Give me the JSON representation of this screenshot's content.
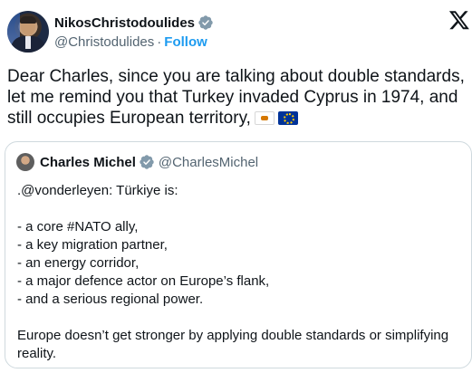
{
  "author": {
    "display_name": "NikosChristodoulides",
    "handle": "@Christodulides",
    "separator": "·",
    "follow_label": "Follow"
  },
  "tweet": {
    "text": "Dear Charles, since you are talking about double standards, let me remind you that Turkey invaded Cyprus in 1974, and still occupies European territory,",
    "emojis": [
      "cyprus-flag",
      "eu-flag"
    ]
  },
  "quoted": {
    "display_name": "Charles Michel",
    "handle": "@CharlesMichel",
    "lines": [
      ".@vonderleyen: Türkiye is:",
      "",
      "- a core #NATO ally,",
      "- a key migration partner,",
      "- an energy corridor,",
      "- a major defence actor on Europe’s flank,",
      "- and a serious regional power.",
      "",
      "Europe doesn’t get stronger by applying double standards or simplifying",
      "reality."
    ]
  },
  "colors": {
    "text": "#0f1419",
    "secondary": "#536471",
    "accent": "#1d9bf0",
    "verified_badge": "#829aab",
    "border": "#cfd9de"
  },
  "icons": {
    "brand": "x-logo-icon",
    "verified": "verified-badge-icon"
  }
}
